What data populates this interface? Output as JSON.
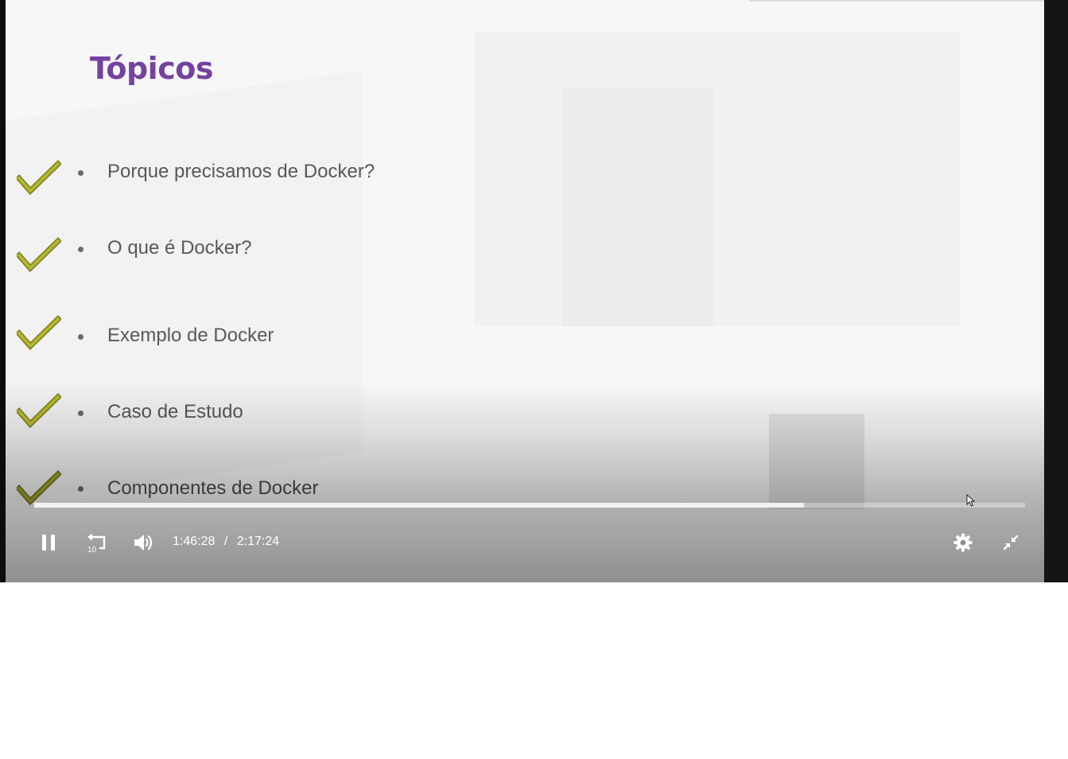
{
  "slide": {
    "title": "Tópicos",
    "topics": [
      {
        "label": "Porque precisamos de Docker?",
        "checked": true
      },
      {
        "label": "O que é Docker?",
        "checked": true
      },
      {
        "label": "Exemplo de Docker",
        "checked": true
      },
      {
        "label": "Caso de Estudo",
        "checked": true
      },
      {
        "label": "Componentes de Docker",
        "checked": true
      }
    ],
    "colors": {
      "title": "#7542a0",
      "check": "#b3b72e",
      "text": "#585858"
    }
  },
  "player": {
    "progress_fraction": 0.777,
    "current_time": "1:46:28",
    "separator": "/",
    "duration": "2:17:24",
    "replay_seconds": "10",
    "icons": {
      "play_pause": "pause-icon",
      "replay": "replay-10-icon",
      "volume": "volume-icon",
      "settings": "gear-icon",
      "fullscreen": "exit-fullscreen-icon"
    }
  }
}
